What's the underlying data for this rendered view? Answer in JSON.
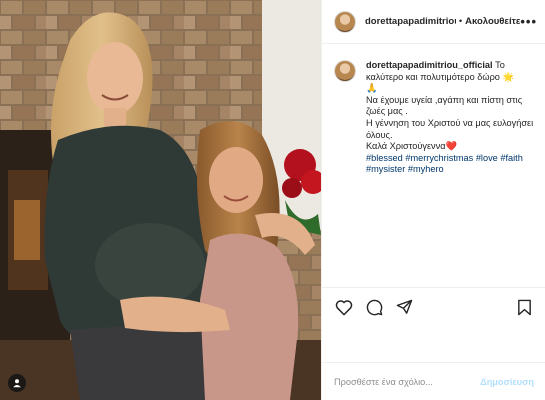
{
  "post": {
    "username": "dorettapapadimitriou_official",
    "username_header": "dorettapapadimitriou_official",
    "dot": "•",
    "follow_label": "Ακολουθείτε",
    "more_label": "•••"
  },
  "caption": {
    "username": "dorettapapadimitriou_official",
    "line1": "Το καλύτερο και πολυτιμότερο δώρο",
    "line1_emoji": "🌟",
    "praying_emoji": "🙏",
    "line2": "Να έχουμε υγεία ,αγάπη και πίστη στις ζωές μας .",
    "line3": "Η γέννηση του Χριστού να μας ευλογήσει όλους.",
    "line4": "Καλά Χριστούγεννα",
    "heart_emoji": "❤️",
    "hashtags": [
      "#blessed",
      "#merrychristmas",
      "#love",
      "#faith",
      "#mysister",
      "#myhero"
    ]
  },
  "actions": {
    "like": "heart-outline-icon",
    "comment": "comment-bubble-icon",
    "share": "paper-plane-icon",
    "save": "bookmark-icon"
  },
  "comment": {
    "placeholder": "Προσθέστε ένα σχόλιο...",
    "post_label": "Δημοσίευση"
  },
  "colors": {
    "hashtag": "#00376b",
    "post_button_disabled": "#b2dffc",
    "border": "#efefef"
  }
}
